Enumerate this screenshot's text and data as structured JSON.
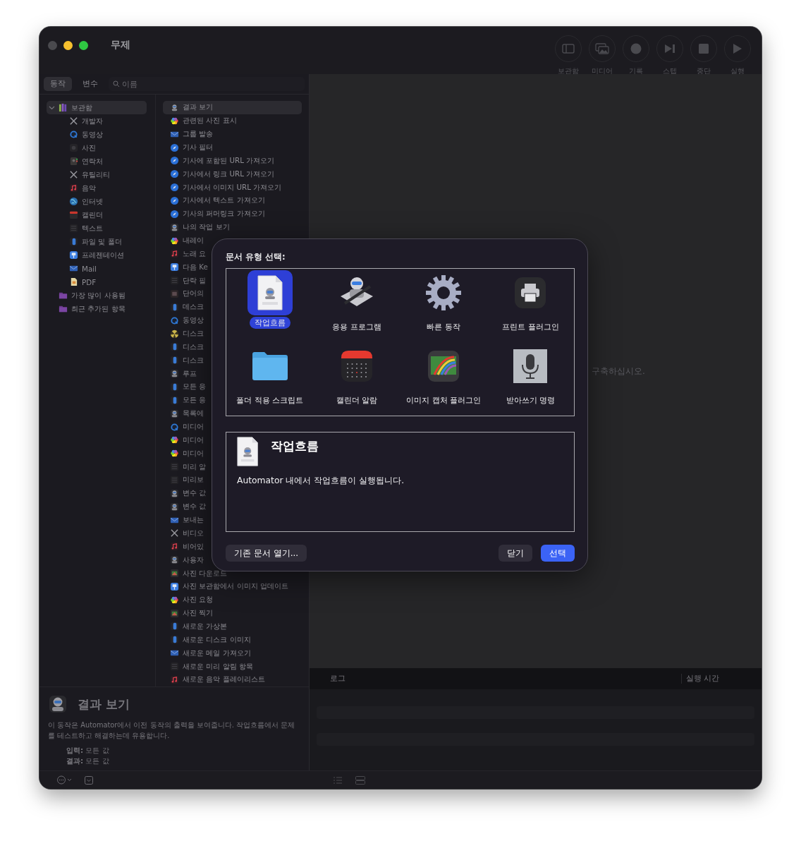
{
  "window": {
    "title": "무제"
  },
  "toolbar": [
    {
      "label": "보관함"
    },
    {
      "label": "미디어"
    },
    {
      "label": "기록"
    },
    {
      "label": "스텝"
    },
    {
      "label": "중단"
    },
    {
      "label": "실행"
    }
  ],
  "library_tabs": [
    {
      "label": "동작",
      "selected": true
    },
    {
      "label": "변수",
      "selected": false
    }
  ],
  "search": {
    "placeholder": "이름"
  },
  "library": [
    {
      "label": "보관함",
      "expanded": true,
      "selected": true,
      "children": [
        {
          "label": "개발자",
          "selected": false
        },
        {
          "label": "동영상",
          "selected": false
        },
        {
          "label": "사진",
          "selected": false
        },
        {
          "label": "연락처",
          "selected": false
        },
        {
          "label": "유틸리티",
          "selected": false
        },
        {
          "label": "음악",
          "selected": false
        },
        {
          "label": "인터넷",
          "selected": false
        },
        {
          "label": "캘린더",
          "selected": false
        },
        {
          "label": "텍스트",
          "selected": false
        },
        {
          "label": "파일 및 폴더",
          "selected": false
        },
        {
          "label": "프레젠테이션",
          "selected": false
        },
        {
          "label": "Mail",
          "selected": false
        },
        {
          "label": "PDF",
          "selected": false
        }
      ]
    },
    {
      "label": "가장 많이 사용됨",
      "selected": false
    },
    {
      "label": "최근 추가된 항목",
      "selected": false
    }
  ],
  "actions": [
    {
      "label": "결과 보기",
      "selected": true
    },
    {
      "label": "관련된 사진 표시",
      "selected": false
    },
    {
      "label": "그룹 발송",
      "selected": false
    },
    {
      "label": "기사 필터",
      "selected": false
    },
    {
      "label": "기사에 포함된 URL 가져오기",
      "selected": false
    },
    {
      "label": "기사에서 링크 URL 가져오기",
      "selected": false
    },
    {
      "label": "기사에서 이미지 URL 가져오기",
      "selected": false
    },
    {
      "label": "기사에서 텍스트 가져오기",
      "selected": false
    },
    {
      "label": "기사의 퍼머링크 가져오기",
      "selected": false
    },
    {
      "label": "나의 작업 보기",
      "selected": false
    },
    {
      "label": "내레이",
      "selected": false
    },
    {
      "label": "노래 요",
      "selected": false
    },
    {
      "label": "다음 Ke",
      "selected": false
    },
    {
      "label": "단락 필",
      "selected": false
    },
    {
      "label": "단어의",
      "selected": false
    },
    {
      "label": "데스크",
      "selected": false
    },
    {
      "label": "동영상",
      "selected": false
    },
    {
      "label": "디스크",
      "selected": false
    },
    {
      "label": "디스크",
      "selected": false
    },
    {
      "label": "디스크",
      "selected": false
    },
    {
      "label": "루프",
      "selected": false
    },
    {
      "label": "모든 응",
      "selected": false
    },
    {
      "label": "모든 응",
      "selected": false
    },
    {
      "label": "목록에",
      "selected": false
    },
    {
      "label": "미디어",
      "selected": false
    },
    {
      "label": "미디어",
      "selected": false
    },
    {
      "label": "미디어",
      "selected": false
    },
    {
      "label": "미리 알",
      "selected": false
    },
    {
      "label": "미리보",
      "selected": false
    },
    {
      "label": "변수 값",
      "selected": false
    },
    {
      "label": "변수 값",
      "selected": false
    },
    {
      "label": "보내는",
      "selected": false
    },
    {
      "label": "비디오",
      "selected": false
    },
    {
      "label": "비어있",
      "selected": false
    },
    {
      "label": "사용자",
      "selected": false
    },
    {
      "label": "사진 다운로드",
      "selected": false
    },
    {
      "label": "사진 보관함에서 이미지 업데이트",
      "selected": false
    },
    {
      "label": "사진 요청",
      "selected": false
    },
    {
      "label": "사진 찍기",
      "selected": false
    },
    {
      "label": "새로운 가상본",
      "selected": false
    },
    {
      "label": "새로운 디스크 이미지",
      "selected": false
    },
    {
      "label": "새로운 메일 가져오기",
      "selected": false
    },
    {
      "label": "새로운 미리 알림 항목",
      "selected": false
    },
    {
      "label": "새로운 음악 플레이리스트",
      "selected": false
    }
  ],
  "description": {
    "title": "결과 보기",
    "text": "이 동작은 Automator에서 이전 동작의 출력을 보여줍니다. 작업흐름에서 문제를 테스트하고 해결하는데 유용합니다.",
    "properties": [
      {
        "label": "입력:",
        "value": "모든 값"
      },
      {
        "label": "결과:",
        "value": "모든 값"
      }
    ]
  },
  "canvas": {
    "hint": "구축하십시오."
  },
  "log": {
    "columns": [
      "로그",
      "실행 시간"
    ]
  },
  "dialog": {
    "title": "문서 유형 선택:",
    "types": [
      {
        "label": "작업흐름",
        "selected": true
      },
      {
        "label": "응용 프로그램",
        "selected": false
      },
      {
        "label": "빠른 동작",
        "selected": false
      },
      {
        "label": "프린트 플러그인",
        "selected": false
      },
      {
        "label": "폴더 적용 스크립트",
        "selected": false
      },
      {
        "label": "캘린더 알람",
        "selected": false
      },
      {
        "label": "이미지 캡처 플러그인",
        "selected": false
      },
      {
        "label": "받아쓰기 명령",
        "selected": false
      }
    ],
    "info": {
      "title": "작업흐름",
      "text": "Automator 내에서 작업흐름이 실행됩니다."
    },
    "buttons": [
      {
        "label": "기존 문서 열기...",
        "kind": "secondary"
      },
      {
        "label": "닫기",
        "kind": "secondary"
      },
      {
        "label": "선택",
        "kind": "primary"
      }
    ]
  }
}
